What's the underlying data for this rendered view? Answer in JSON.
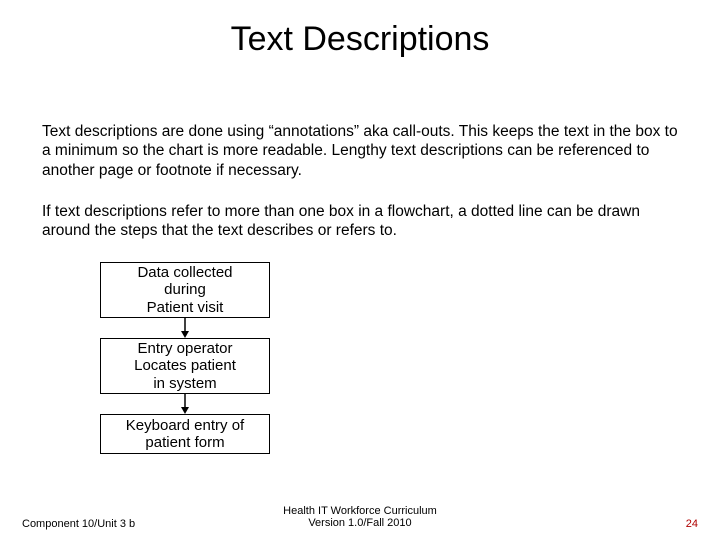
{
  "title": "Text Descriptions",
  "paragraphs": {
    "p1": "Text descriptions are done using “annotations” aka call-outs.  This keeps the text in the box to a minimum so the chart is more readable.  Lengthy text descriptions can be referenced to another page or footnote if necessary.",
    "p2": "If text descriptions refer to more than one box in a flowchart, a dotted line can be drawn around the steps that the text describes or refers to."
  },
  "flow": {
    "box1_line1": "Data collected",
    "box1_line2": "during",
    "box1_line3": "Patient visit",
    "box2_line1": "Entry operator",
    "box2_line2": "Locates patient",
    "box2_line3": "in system",
    "box3_line1": "Keyboard entry of",
    "box3_line2": "patient form"
  },
  "footer": {
    "left": "Component 10/Unit 3 b",
    "center_line1": "Health IT Workforce Curriculum",
    "center_line2": "Version 1.0/Fall 2010",
    "right": "24"
  }
}
